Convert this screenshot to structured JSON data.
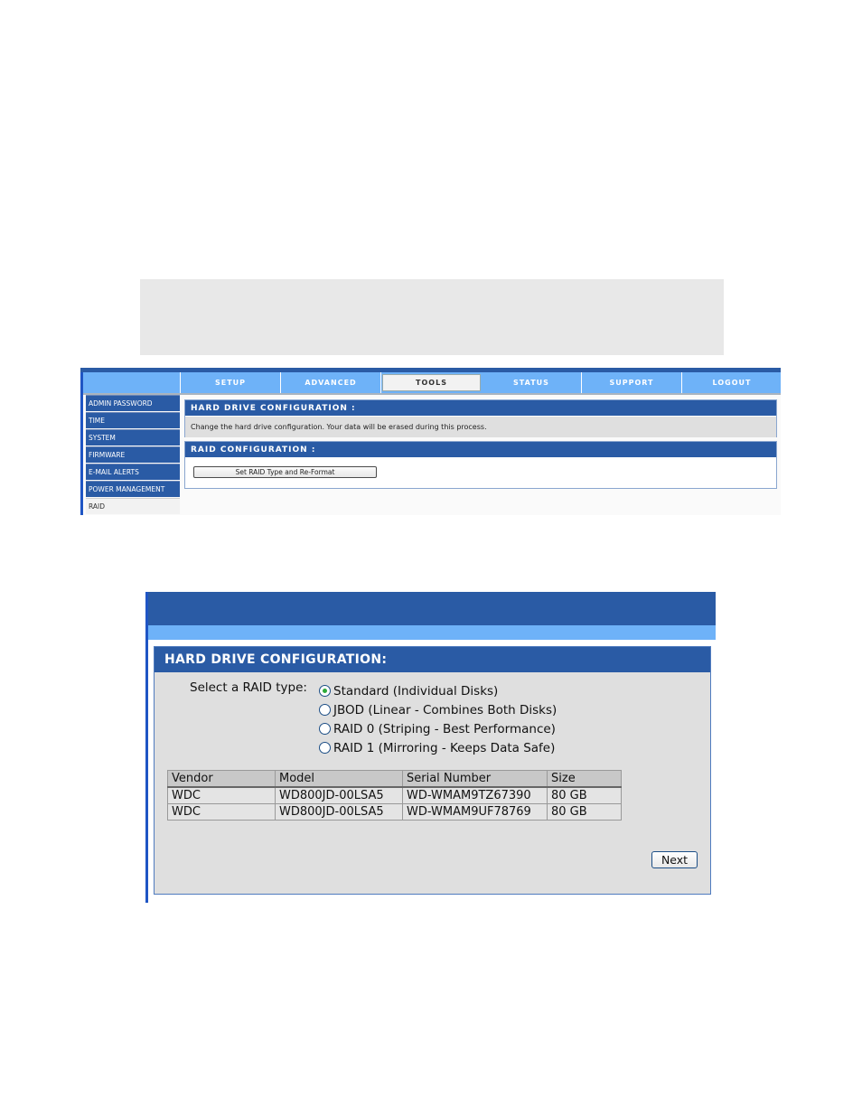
{
  "router_ui": {
    "nav_tabs": [
      {
        "label": "SETUP",
        "active": false
      },
      {
        "label": "ADVANCED",
        "active": false
      },
      {
        "label": "TOOLS",
        "active": true
      },
      {
        "label": "STATUS",
        "active": false
      },
      {
        "label": "SUPPORT",
        "active": false
      },
      {
        "label": "LOGOUT",
        "active": false
      }
    ],
    "sidebar": {
      "items": [
        {
          "label": "ADMIN PASSWORD",
          "active": false
        },
        {
          "label": "TIME",
          "active": false
        },
        {
          "label": "SYSTEM",
          "active": false
        },
        {
          "label": "FIRMWARE",
          "active": false
        },
        {
          "label": "E-MAIL ALERTS",
          "active": false
        },
        {
          "label": "POWER MANAGEMENT",
          "active": false
        },
        {
          "label": "RAID",
          "active": true
        }
      ]
    },
    "hard_drive_panel": {
      "title": "HARD DRIVE CONFIGURATION :",
      "description": "Change the hard drive configuration. Your data will be erased during this process."
    },
    "raid_panel": {
      "title": "RAID CONFIGURATION :",
      "button_label": "Set RAID Type and Re-Format"
    }
  },
  "raid_wizard": {
    "title": "HARD DRIVE CONFIGURATION:",
    "select_label": "Select a RAID type:",
    "options": [
      {
        "label": "Standard (Individual Disks)",
        "checked": true
      },
      {
        "label": "JBOD (Linear - Combines Both Disks)",
        "checked": false
      },
      {
        "label": "RAID 0 (Striping - Best Performance)",
        "checked": false
      },
      {
        "label": "RAID 1 (Mirroring - Keeps Data Safe)",
        "checked": false
      }
    ],
    "table": {
      "headers": [
        "Vendor",
        "Model",
        "Serial Number",
        "Size"
      ],
      "rows": [
        [
          "WDC",
          "WD800JD-00LSA5",
          "WD-WMAM9TZ67390",
          "80 GB"
        ],
        [
          "WDC",
          "WD800JD-00LSA5",
          "WD-WMAM9UF78769",
          "80 GB"
        ]
      ]
    },
    "next_label": "Next"
  },
  "colors": {
    "header_blue": "#2a5ba5",
    "light_blue": "#6eb2f8",
    "panel_gray": "#dfdfdf",
    "radio_selected": "#2eaa3a"
  }
}
